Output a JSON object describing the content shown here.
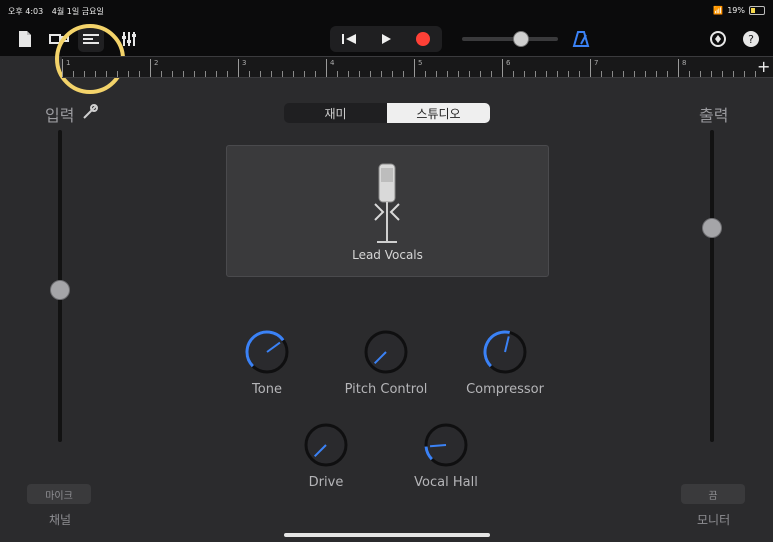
{
  "status": {
    "time": "오후 4:03",
    "date": "4월 1일 금요일",
    "right": {
      "wifi_icon": "wifi-icon",
      "percent": "19%"
    }
  },
  "toolbar": {
    "icons": {
      "document": "document-icon",
      "track_view": "track-view-icon",
      "editor": "editor-icon",
      "mixer": "mixer-icon",
      "rewind": "rewind-icon",
      "play": "play-icon",
      "record": "record-icon",
      "metronome": "metronome-icon",
      "settings": "settings-icon",
      "help": "help-icon"
    },
    "master_volume_value": 0.6
  },
  "ruler": {
    "bars": [
      "1",
      "2",
      "3",
      "4",
      "5",
      "6",
      "7",
      "8"
    ],
    "add_label": "+"
  },
  "input": {
    "label": "입력",
    "level": 0.49,
    "bottom_button": "마이크",
    "bottom_caption": "채널"
  },
  "output": {
    "label": "출력",
    "level": 0.69,
    "bottom_button": "끔",
    "bottom_caption": "모니터"
  },
  "segment": {
    "items": [
      "재미",
      "스튜디오"
    ],
    "selected_index": 1
  },
  "preset": {
    "name": "Lead Vocals"
  },
  "knobs": [
    {
      "label": "Tone",
      "value": 0.7
    },
    {
      "label": "Pitch Control",
      "value": 0.0
    },
    {
      "label": "Compressor",
      "value": 0.55
    },
    {
      "label": "Drive",
      "value": 0.0
    },
    {
      "label": "Vocal Hall",
      "value": 0.15
    }
  ],
  "colors": {
    "accent": "#3b82f6",
    "record": "#ff4036",
    "highlight": "#f3d36a"
  }
}
